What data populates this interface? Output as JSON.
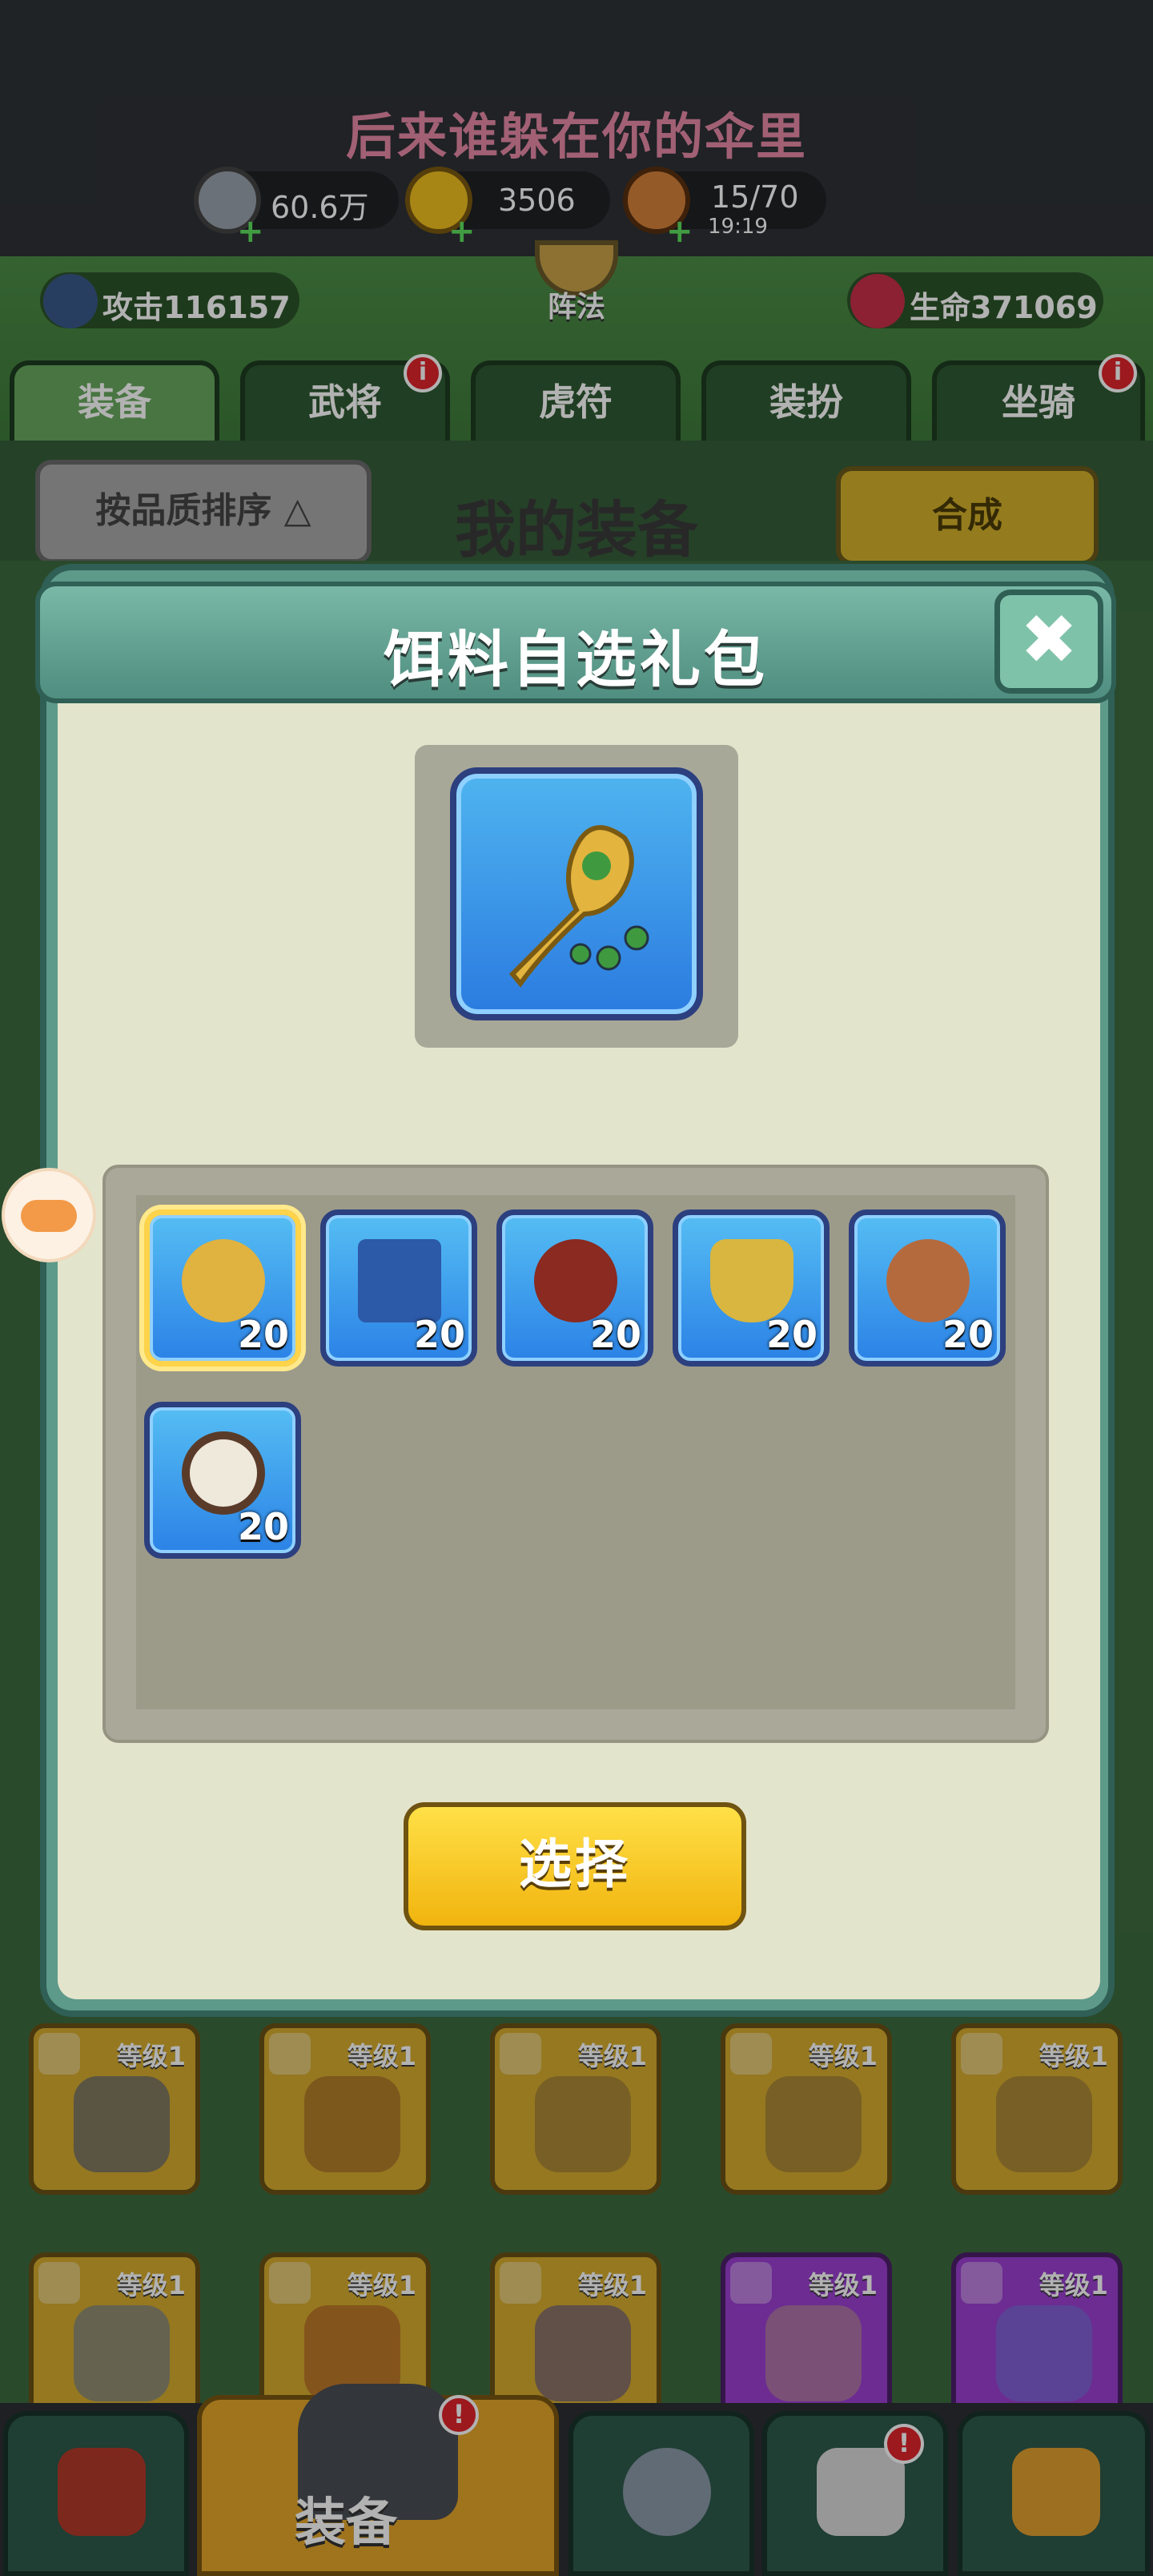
{
  "top": {
    "song_title": "后来谁躲在你的伞里",
    "resources": [
      {
        "name": "silver-coin",
        "value": "60.6万"
      },
      {
        "name": "gold-ingot",
        "value": "3506"
      },
      {
        "name": "meat-stamina",
        "value": "15/70"
      }
    ],
    "stamina_timer": "19:19"
  },
  "header": {
    "attack_label": "攻击116157",
    "formation_label": "阵法",
    "hp_label": "生命371069",
    "tabs": [
      {
        "label": "装备",
        "active": true,
        "badge": ""
      },
      {
        "label": "武将",
        "active": false,
        "badge": "i"
      },
      {
        "label": "虎符",
        "active": false,
        "badge": ""
      },
      {
        "label": "装扮",
        "active": false,
        "badge": ""
      },
      {
        "label": "坐骑",
        "active": false,
        "badge": "i"
      }
    ]
  },
  "equip_bar": {
    "sort_label": "按品质排序 △",
    "title": "我的装备",
    "synth_label": "合成"
  },
  "bg_grid": {
    "level_label": "等级1"
  },
  "modal": {
    "title": "饵料自选礼包",
    "close_glyph": "✖",
    "items": [
      {
        "name": "scepter-item",
        "count": "20",
        "color": "#e0b23f"
      },
      {
        "name": "book-item",
        "count": "20",
        "color": "#2c59a8"
      },
      {
        "name": "wine-jar-item",
        "count": "20",
        "color": "#8a2a20"
      },
      {
        "name": "bronze-cup-item",
        "count": "20",
        "color": "#d8b640"
      },
      {
        "name": "plate-item",
        "count": "20",
        "color": "#b56a3e"
      },
      {
        "name": "tea-leaf-item",
        "count": "20",
        "color": "#5a3b2a"
      }
    ],
    "select_label": "选择"
  },
  "bottom_nav": {
    "active_label": "装备",
    "badge": "!"
  },
  "colors": {
    "accent_yellow": "#ffd21f",
    "modal_teal": "#5e9a8a",
    "item_blue": "#2b82e6",
    "song_pink": "#e98aa8"
  }
}
